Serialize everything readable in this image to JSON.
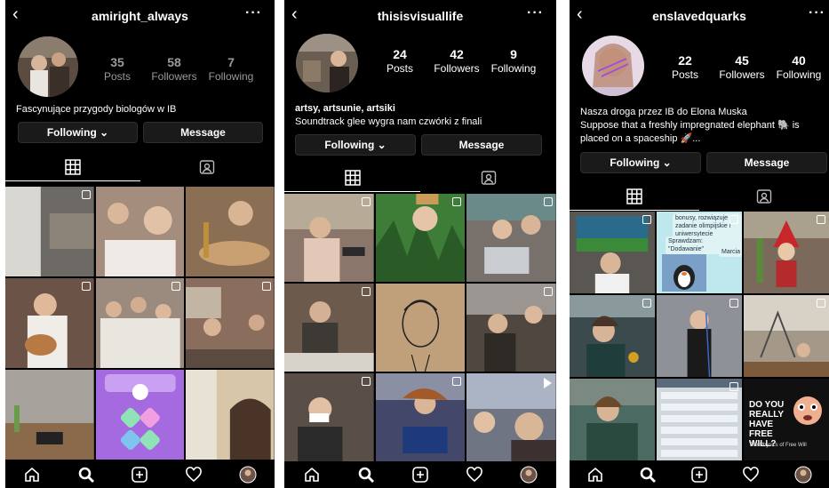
{
  "profiles": [
    {
      "username": "amiright_always",
      "posts": "35",
      "posts_label": "Posts",
      "followers": "58",
      "followers_label": "Followers",
      "following": "7",
      "following_label": "Following",
      "bio_line1": "Fascynujące przygody biologów w IB",
      "following_button": "Following ⌄",
      "message_button": "Message",
      "tiles": [
        "#6d6a66",
        "#a58d7d",
        "#8b6f55",
        "#6b5447",
        "#9a8b7e",
        "#8a6d5c",
        "#a7a29c",
        "#a56ae0",
        "#d7c7a8"
      ]
    },
    {
      "username": "thisisvisuallife",
      "posts": "24",
      "posts_label": "Posts",
      "followers": "42",
      "followers_label": "Followers",
      "following": "9",
      "following_label": "Following",
      "bio_name": "artsy, artsunie, artsiki",
      "bio_line1": "Soundtrack glee wygra nam czwórki z finali",
      "following_button": "Following ⌄",
      "message_button": "Message",
      "tiles": [
        "#8a766a",
        "#3e7d38",
        "#77706b",
        "#6c5b4d",
        "#c0a07a",
        "#4f4740",
        "#5a4e48",
        "#43486a",
        "#6f7583"
      ]
    },
    {
      "username": "enslavedquarks",
      "posts": "22",
      "posts_label": "Posts",
      "followers": "45",
      "followers_label": "Followers",
      "following": "40",
      "following_label": "Following",
      "bio_line1": "Nasza droga przez IB do Elona Muska",
      "bio_line2": "Suppose that a freshly impregnated elephant 🐘 is",
      "bio_line3": "placed on a spaceship 🚀...",
      "following_button": "Following ⌄",
      "message_button": "Message",
      "tiles": [
        "#5a5652",
        "#bfe8ee",
        "#7b6a5c",
        "#3b4a4c",
        "#6b6e74",
        "#a49888",
        "#4a6a62",
        "#cfd6dc",
        "#101010"
      ],
      "chat_bubbles": [
        "bonusy, rozwiązuje zadanie olimpijskie i uniwersytecie",
        "Sprawdzam: \"Dodawanie\"",
        "Marcia"
      ],
      "tile_text": [
        "DO YOU REALLY HAVE FREE WILL?",
        "The Physics of Free Will"
      ]
    }
  ]
}
